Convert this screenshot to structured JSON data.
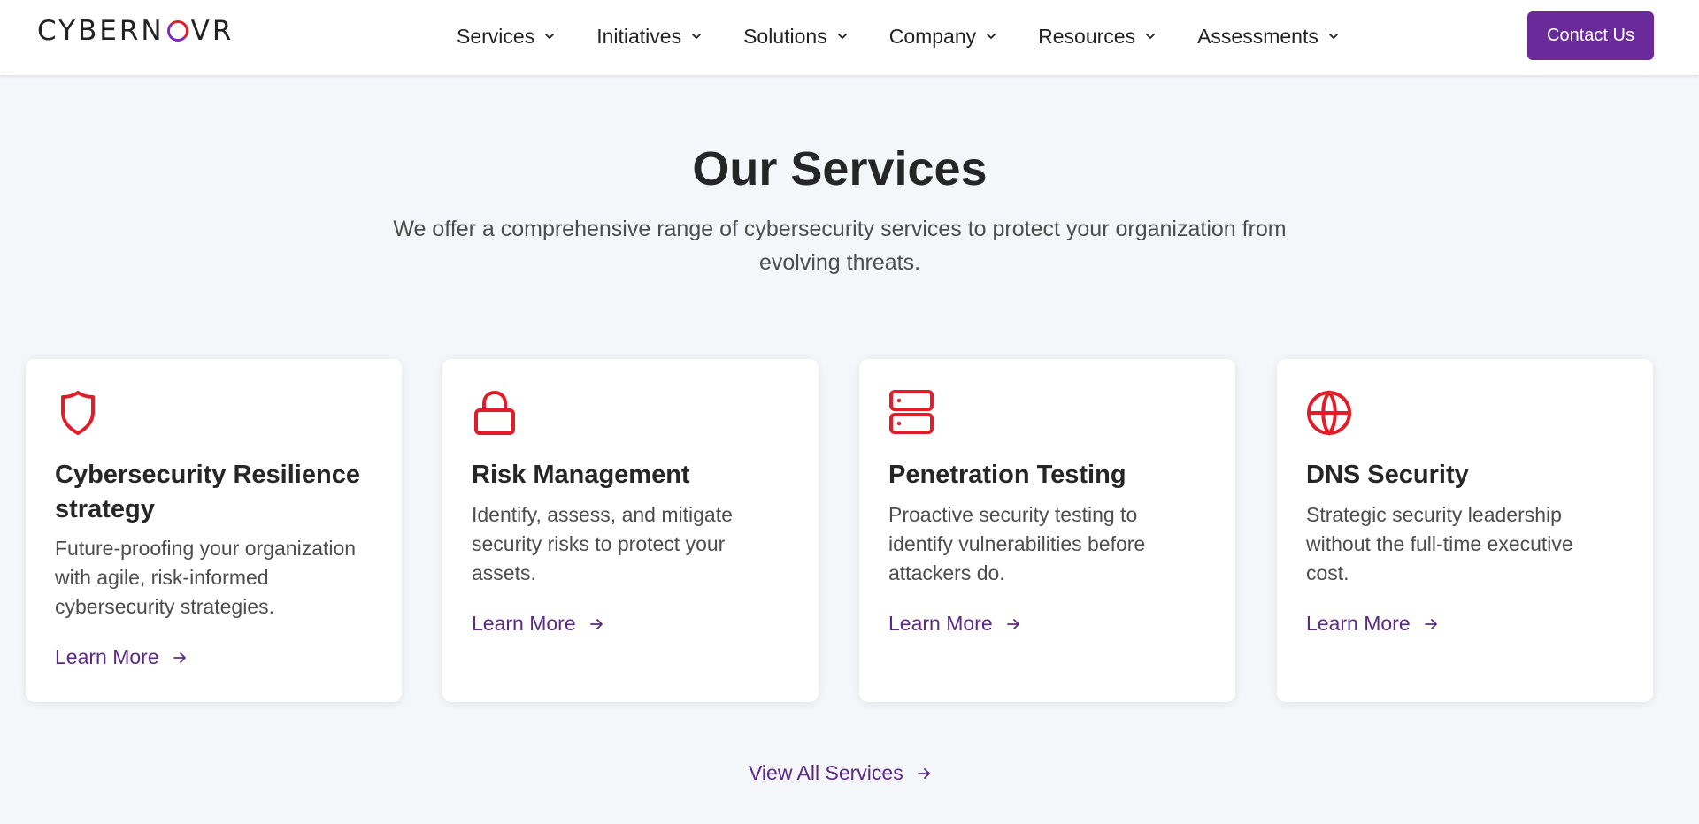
{
  "brand": {
    "logo_left": "CYBERN",
    "logo_right": "VR",
    "accent": "#6a2a9a",
    "icon_color": "#e11d2a"
  },
  "nav": [
    {
      "label": "Services"
    },
    {
      "label": "Initiatives"
    },
    {
      "label": "Solutions"
    },
    {
      "label": "Company"
    },
    {
      "label": "Resources"
    },
    {
      "label": "Assessments"
    }
  ],
  "header": {
    "contact_label": "Contact Us"
  },
  "section": {
    "title": "Our Services",
    "subtitle": "We offer a comprehensive range of cybersecurity services to protect your organization from evolving threats.",
    "view_all_label": "View All Services"
  },
  "cards": [
    {
      "icon": "shield-icon",
      "title": "Cybersecurity Resilience strategy",
      "description": "Future-proofing your organization with agile, risk-informed cybersecurity strategies.",
      "link_label": "Learn More"
    },
    {
      "icon": "lock-icon",
      "title": "Risk Management",
      "description": "Identify, assess, and mitigate security risks to protect your assets.",
      "link_label": "Learn More"
    },
    {
      "icon": "server-icon",
      "title": "Penetration Testing",
      "description": "Proactive security testing to identify vulnerabilities before attackers do.",
      "link_label": "Learn More"
    },
    {
      "icon": "globe-icon",
      "title": "DNS Security",
      "description": "Strategic security leadership without the full-time executive cost.",
      "link_label": "Learn More"
    }
  ]
}
